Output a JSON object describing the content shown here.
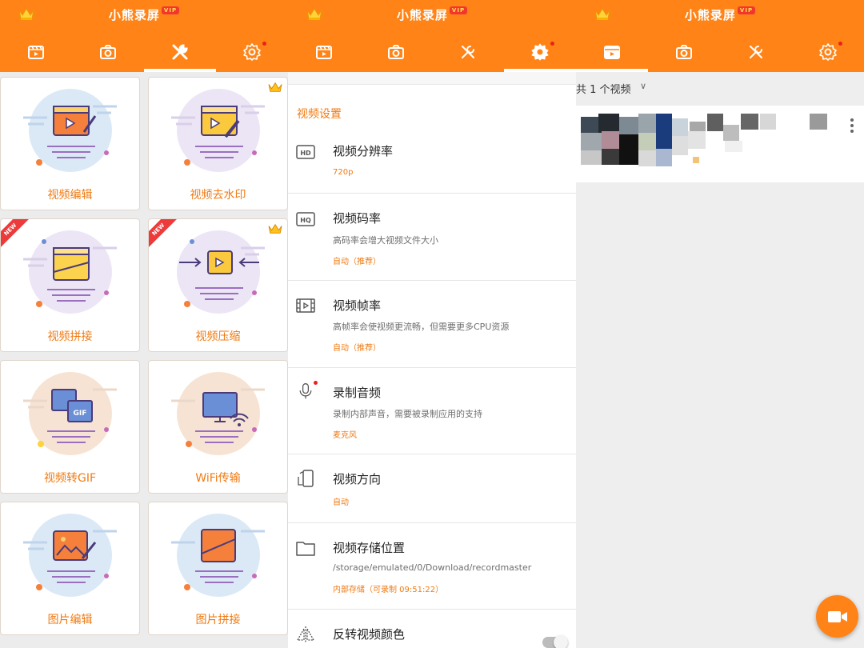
{
  "app": {
    "title": "小熊录屏",
    "vip_badge": "VIP"
  },
  "colors": {
    "brand_orange": "#ff8316",
    "accent_text": "#f07a12",
    "new_ribbon": "#ec3b3a"
  },
  "tabs": [
    {
      "icon": "video-list-icon"
    },
    {
      "icon": "camera-icon"
    },
    {
      "icon": "tools-icon"
    },
    {
      "icon": "settings-gear-icon"
    }
  ],
  "tools": {
    "items": [
      {
        "label": "视频编辑",
        "icon": "video-edit-icon",
        "new": false,
        "vip": false
      },
      {
        "label": "视频去水印",
        "icon": "remove-watermark-icon",
        "new": false,
        "vip": true
      },
      {
        "label": "视频拼接",
        "icon": "video-join-icon",
        "new": true,
        "vip": false
      },
      {
        "label": "视频压缩",
        "icon": "video-compress-icon",
        "new": true,
        "vip": true
      },
      {
        "label": "视频转GIF",
        "icon": "video-to-gif-icon",
        "new": false,
        "vip": false
      },
      {
        "label": "WiFi传输",
        "icon": "wifi-transfer-icon",
        "new": false,
        "vip": false
      },
      {
        "label": "图片编辑",
        "icon": "image-edit-icon",
        "new": false,
        "vip": false
      },
      {
        "label": "图片拼接",
        "icon": "image-join-icon",
        "new": false,
        "vip": false
      }
    ],
    "new_label": "NEW",
    "gif_label": "GIF"
  },
  "settings": {
    "section_title": "视频设置",
    "rows": [
      {
        "name": "视频分辨率",
        "desc": "",
        "value": "720p",
        "icon": "hd-icon"
      },
      {
        "name": "视频码率",
        "desc": "高码率会增大视频文件大小",
        "value": "自动（推荐）",
        "icon": "hq-icon"
      },
      {
        "name": "视频帧率",
        "desc": "高帧率会使视频更流畅，但需要更多CPU资源",
        "value": "自动（推荐）",
        "icon": "film-icon"
      },
      {
        "name": "录制音频",
        "desc": "录制内部声音，需要被录制应用的支持",
        "value": "麦克风",
        "icon": "microphone-icon"
      },
      {
        "name": "视频方向",
        "desc": "",
        "value": "自动",
        "icon": "rotate-phone-icon"
      },
      {
        "name": "视频存储位置",
        "desc": "/storage/emulated/0/Download/recordmaster",
        "value": "内部存储（可录制 09:51:22）",
        "icon": "folder-icon"
      },
      {
        "name": "反转视频颜色",
        "desc": "",
        "value": "",
        "icon": "invert-color-icon",
        "toggle": false
      }
    ]
  },
  "videos": {
    "count_label": "共 1 个视频",
    "chevron": "∨"
  }
}
